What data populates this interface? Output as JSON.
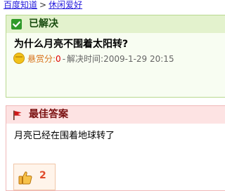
{
  "breadcrumb": {
    "home": "百度知道",
    "separator": ">",
    "category": "休闲爱好"
  },
  "solved_panel": {
    "status": "已解决",
    "question": "为什么月亮不围着太阳转?",
    "reward_label": "悬赏分:",
    "reward_value": "0",
    "separator": "-",
    "resolved_time": "解决时间:2009-1-29 20:15",
    "colors": {
      "reward_label": "#d8721a",
      "reward_value": "#e00000",
      "header": "#e3f2cd"
    }
  },
  "best_panel": {
    "title": "最佳答案",
    "answer": "月亮已经在围着地球转了",
    "vote_count": "2",
    "icons": [
      "flag-icon",
      "thumbs-up-icon"
    ]
  }
}
